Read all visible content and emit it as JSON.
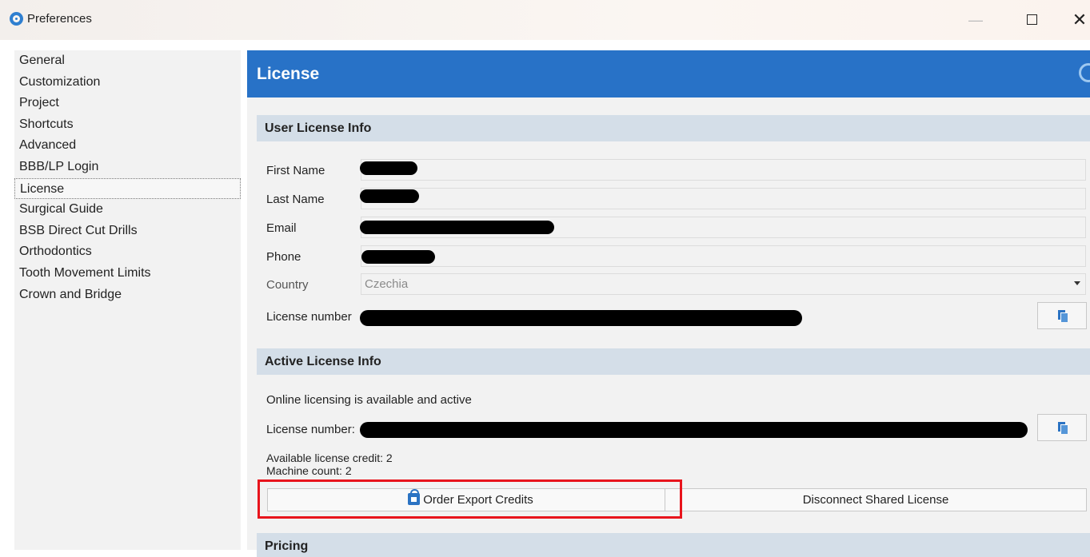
{
  "window": {
    "title": "Preferences",
    "minimize": "—",
    "close": "✕"
  },
  "sidebar": {
    "items": [
      {
        "label": "General"
      },
      {
        "label": "Customization"
      },
      {
        "label": "Project"
      },
      {
        "label": "Shortcuts"
      },
      {
        "label": "Advanced"
      },
      {
        "label": "BBB/LP Login"
      },
      {
        "label": "License",
        "active": true
      },
      {
        "label": "Surgical Guide"
      },
      {
        "label": "BSB Direct Cut Drills"
      },
      {
        "label": "Orthodontics"
      },
      {
        "label": "Tooth Movement Limits"
      },
      {
        "label": "Crown and Bridge"
      }
    ]
  },
  "header": {
    "title": "License"
  },
  "user_license": {
    "title": "User License Info",
    "first_name_label": "First Name",
    "last_name_label": "Last Name",
    "email_label": "Email",
    "phone_label": "Phone",
    "country_label": "Country",
    "country_value": "Czechia",
    "license_number_label": "License number"
  },
  "active_license": {
    "title": "Active License Info",
    "status": "Online licensing is available and active",
    "license_number_label": "License number:",
    "credit": "Available license credit: 2",
    "machine_count": "Machine count: 2",
    "order_button": "Order Export Credits",
    "disconnect_button": "Disconnect Shared License"
  },
  "pricing": {
    "title": "Pricing"
  },
  "colors": {
    "header": "#2872c7",
    "highlight": "#e8141c",
    "section": "#d4dee8"
  },
  "icons": [
    "app-logo-icon",
    "copy-icon",
    "shopping-bag-icon",
    "dropdown-arrow-icon"
  ]
}
